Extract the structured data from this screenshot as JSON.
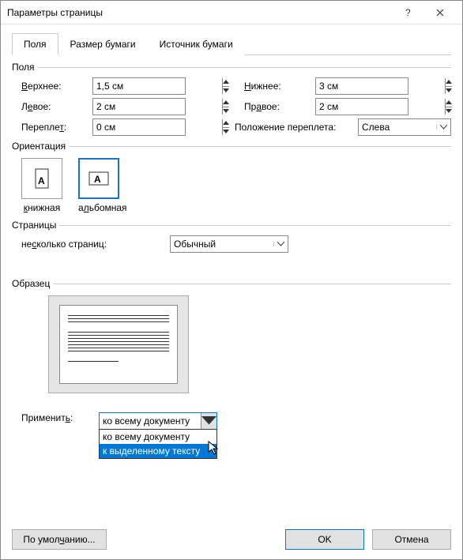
{
  "window": {
    "title": "Параметры страницы"
  },
  "tabs": {
    "margins": "Поля",
    "paper": "Размер бумаги",
    "source": "Источник бумаги"
  },
  "groups": {
    "margins": "Поля",
    "orientation": "Ориентация",
    "pages": "Страницы",
    "preview": "Образец"
  },
  "margins": {
    "top_label": "Верхнее:",
    "top_value": "1,5 см",
    "bottom_label": "Нижнее:",
    "bottom_value": "3 см",
    "left_label": "Левое:",
    "left_value": "2 см",
    "right_label": "Правое:",
    "right_value": "2 см",
    "gutter_label": "Переплет:",
    "gutter_value": "0 см",
    "gutter_pos_label": "Положение переплета:",
    "gutter_pos_value": "Слева"
  },
  "orientation": {
    "portrait": "книжная",
    "landscape": "альбомная"
  },
  "pages": {
    "multi_label": "несколько страниц:",
    "multi_value": "Обычный"
  },
  "apply": {
    "label": "Применить:",
    "selected": "ко всему документу",
    "options": [
      "ко всему документу",
      "к выделенному тексту"
    ]
  },
  "buttons": {
    "default": "По умолчанию...",
    "ok": "OK",
    "cancel": "Отмена"
  }
}
